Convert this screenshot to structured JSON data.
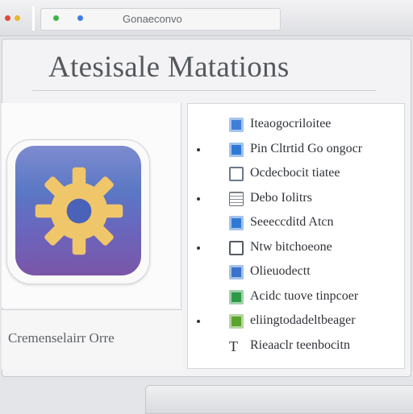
{
  "window": {
    "address_text": "Gonaeconvo",
    "title": "Atesisale Matations"
  },
  "app_icon": {
    "name": "gear-app-icon"
  },
  "left_footer": {
    "label": "Cremenselairr Orre"
  },
  "list": [
    {
      "label": "Iteaogocriloitee",
      "icon": "blue-app-icon",
      "icon_color": "#3f7fd8",
      "bullet": false
    },
    {
      "label": "Pin Cltrtid Go ongocr",
      "icon": "blue-app-icon",
      "icon_color": "#2f79d6",
      "bullet": true
    },
    {
      "label": "Ocdecbocit tiatee",
      "icon": "window-icon",
      "icon_color": "#6a7a8c",
      "bullet": false
    },
    {
      "label": "Debo Iolitrs",
      "icon": "grid-icon",
      "icon_color": "#4a7a4a",
      "bullet": true
    },
    {
      "label": "Seeeccditd Atcn",
      "icon": "blue-bar-icon",
      "icon_color": "#2f79d6",
      "bullet": false
    },
    {
      "label": "Ntw bitchoeone",
      "icon": "window-icon",
      "icon_color": "#555b63",
      "bullet": true
    },
    {
      "label": "Olieuodectt",
      "icon": "blue-app-icon",
      "icon_color": "#3a73c9",
      "bullet": false
    },
    {
      "label": "Acidc tuove tinpcoer",
      "icon": "green-app-icon",
      "icon_color": "#2e9a48",
      "bullet": false
    },
    {
      "label": "eliingtodadeltbeager",
      "icon": "green-app-icon",
      "icon_color": "#5aa42d",
      "bullet": true
    },
    {
      "label": "Rieaaclr teenbocitn",
      "icon": "text-icon",
      "icon_color": "#333333",
      "bullet": false
    }
  ],
  "colors": {
    "accent_blue": "#3f7fd8",
    "dot_red": "#e04a3a",
    "dot_yellow": "#e8b82a",
    "dot_green": "#3fb34a",
    "dot_blue": "#3d7fe0",
    "gear": "#f0c66a"
  }
}
